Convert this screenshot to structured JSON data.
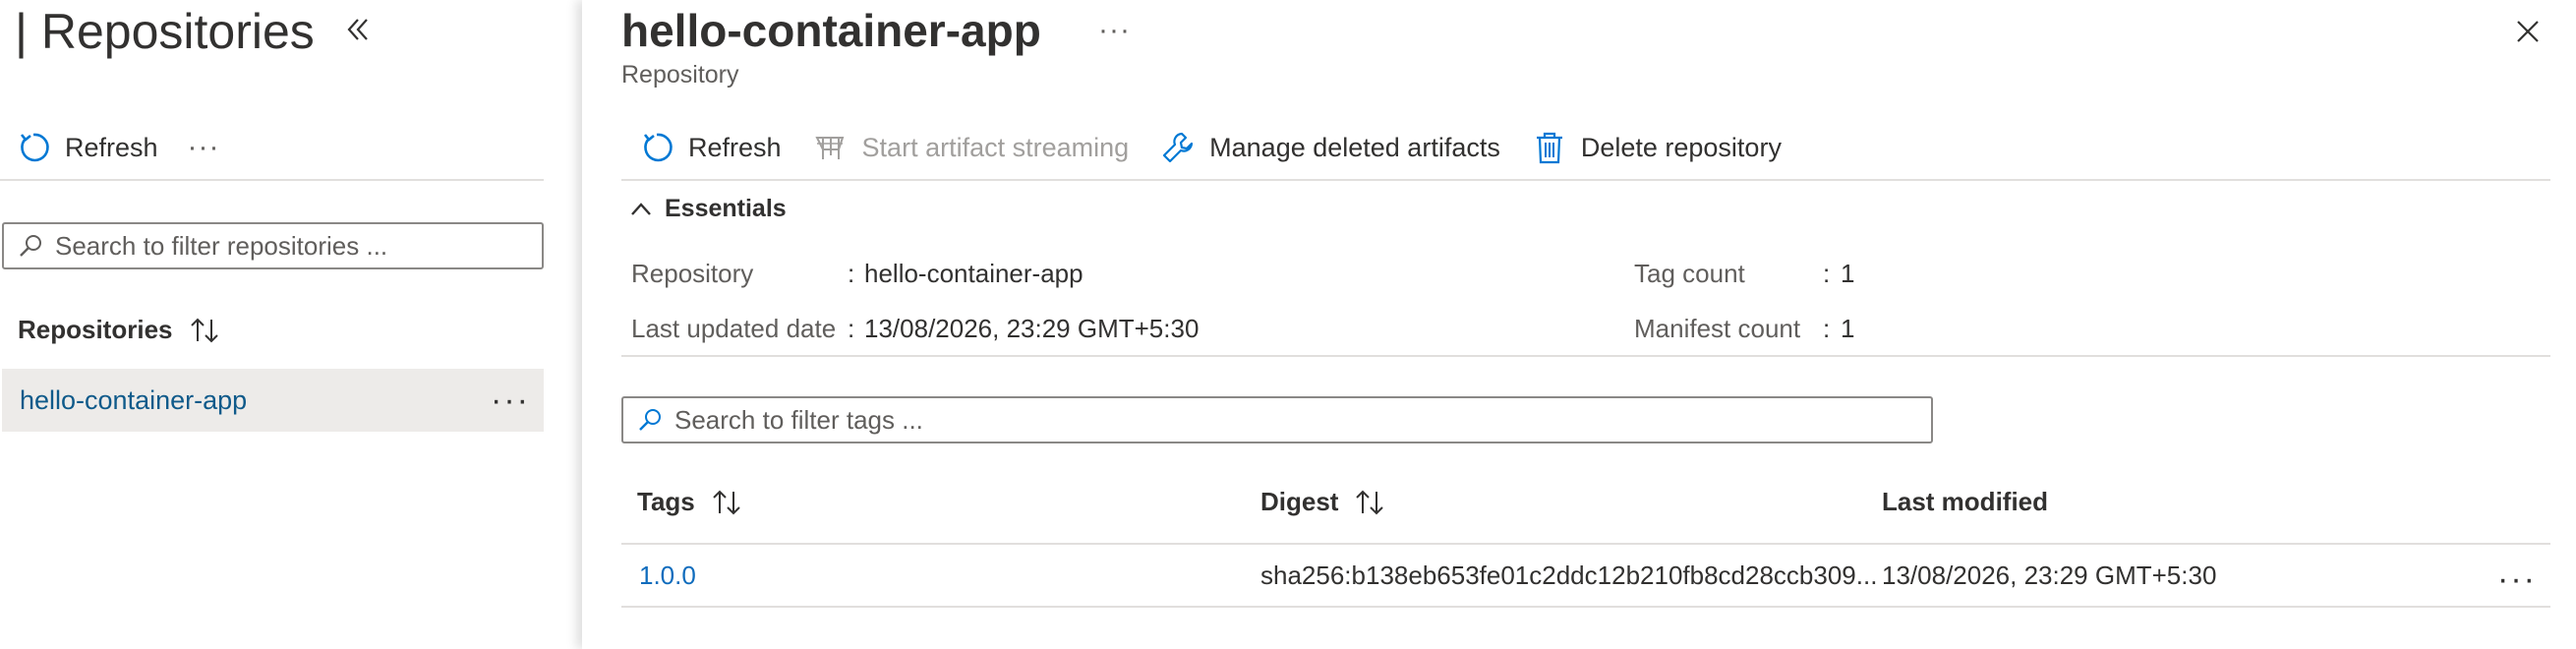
{
  "left_pane": {
    "title": "| Repositories",
    "collapse_icon": "double-chevron-left-icon",
    "refresh_label": "Refresh",
    "more_label": "···",
    "search_placeholder": "Search to filter repositories ...",
    "list_header": "Repositories",
    "items": [
      {
        "label": "hello-container-app",
        "more": "···"
      }
    ]
  },
  "blade": {
    "title": "hello-container-app",
    "title_more": "···",
    "subtitle": "Repository",
    "close_icon": "close-icon",
    "toolbar": {
      "refresh": "Refresh",
      "start_streaming": "Start artifact streaming",
      "manage_deleted": "Manage deleted artifacts",
      "delete_repo": "Delete repository"
    },
    "essentials": {
      "toggle_label": "Essentials",
      "repository_label": "Repository",
      "repository_value": "hello-container-app",
      "last_updated_label": "Last updated date",
      "last_updated_value": "13/08/2026, 23:29 GMT+5:30",
      "tag_count_label": "Tag count",
      "tag_count_value": "1",
      "manifest_count_label": "Manifest count",
      "manifest_count_value": "1",
      "separator": ":"
    },
    "tags_search_placeholder": "Search to filter tags ...",
    "table": {
      "columns": [
        "Tags",
        "Digest",
        "Last modified"
      ],
      "rows": [
        {
          "tag": "1.0.0",
          "digest": "sha256:b138eb653fe01c2ddc12b210fb8cd28ccb309...",
          "last_modified": "13/08/2026, 23:29 GMT+5:30",
          "more": "···"
        }
      ]
    }
  },
  "colors": {
    "accent": "#0078d4",
    "link": "#0f6cbd",
    "selected_row": "#edebe9",
    "divider": "#e1dfdd",
    "disabled_text": "#a19f9d"
  }
}
